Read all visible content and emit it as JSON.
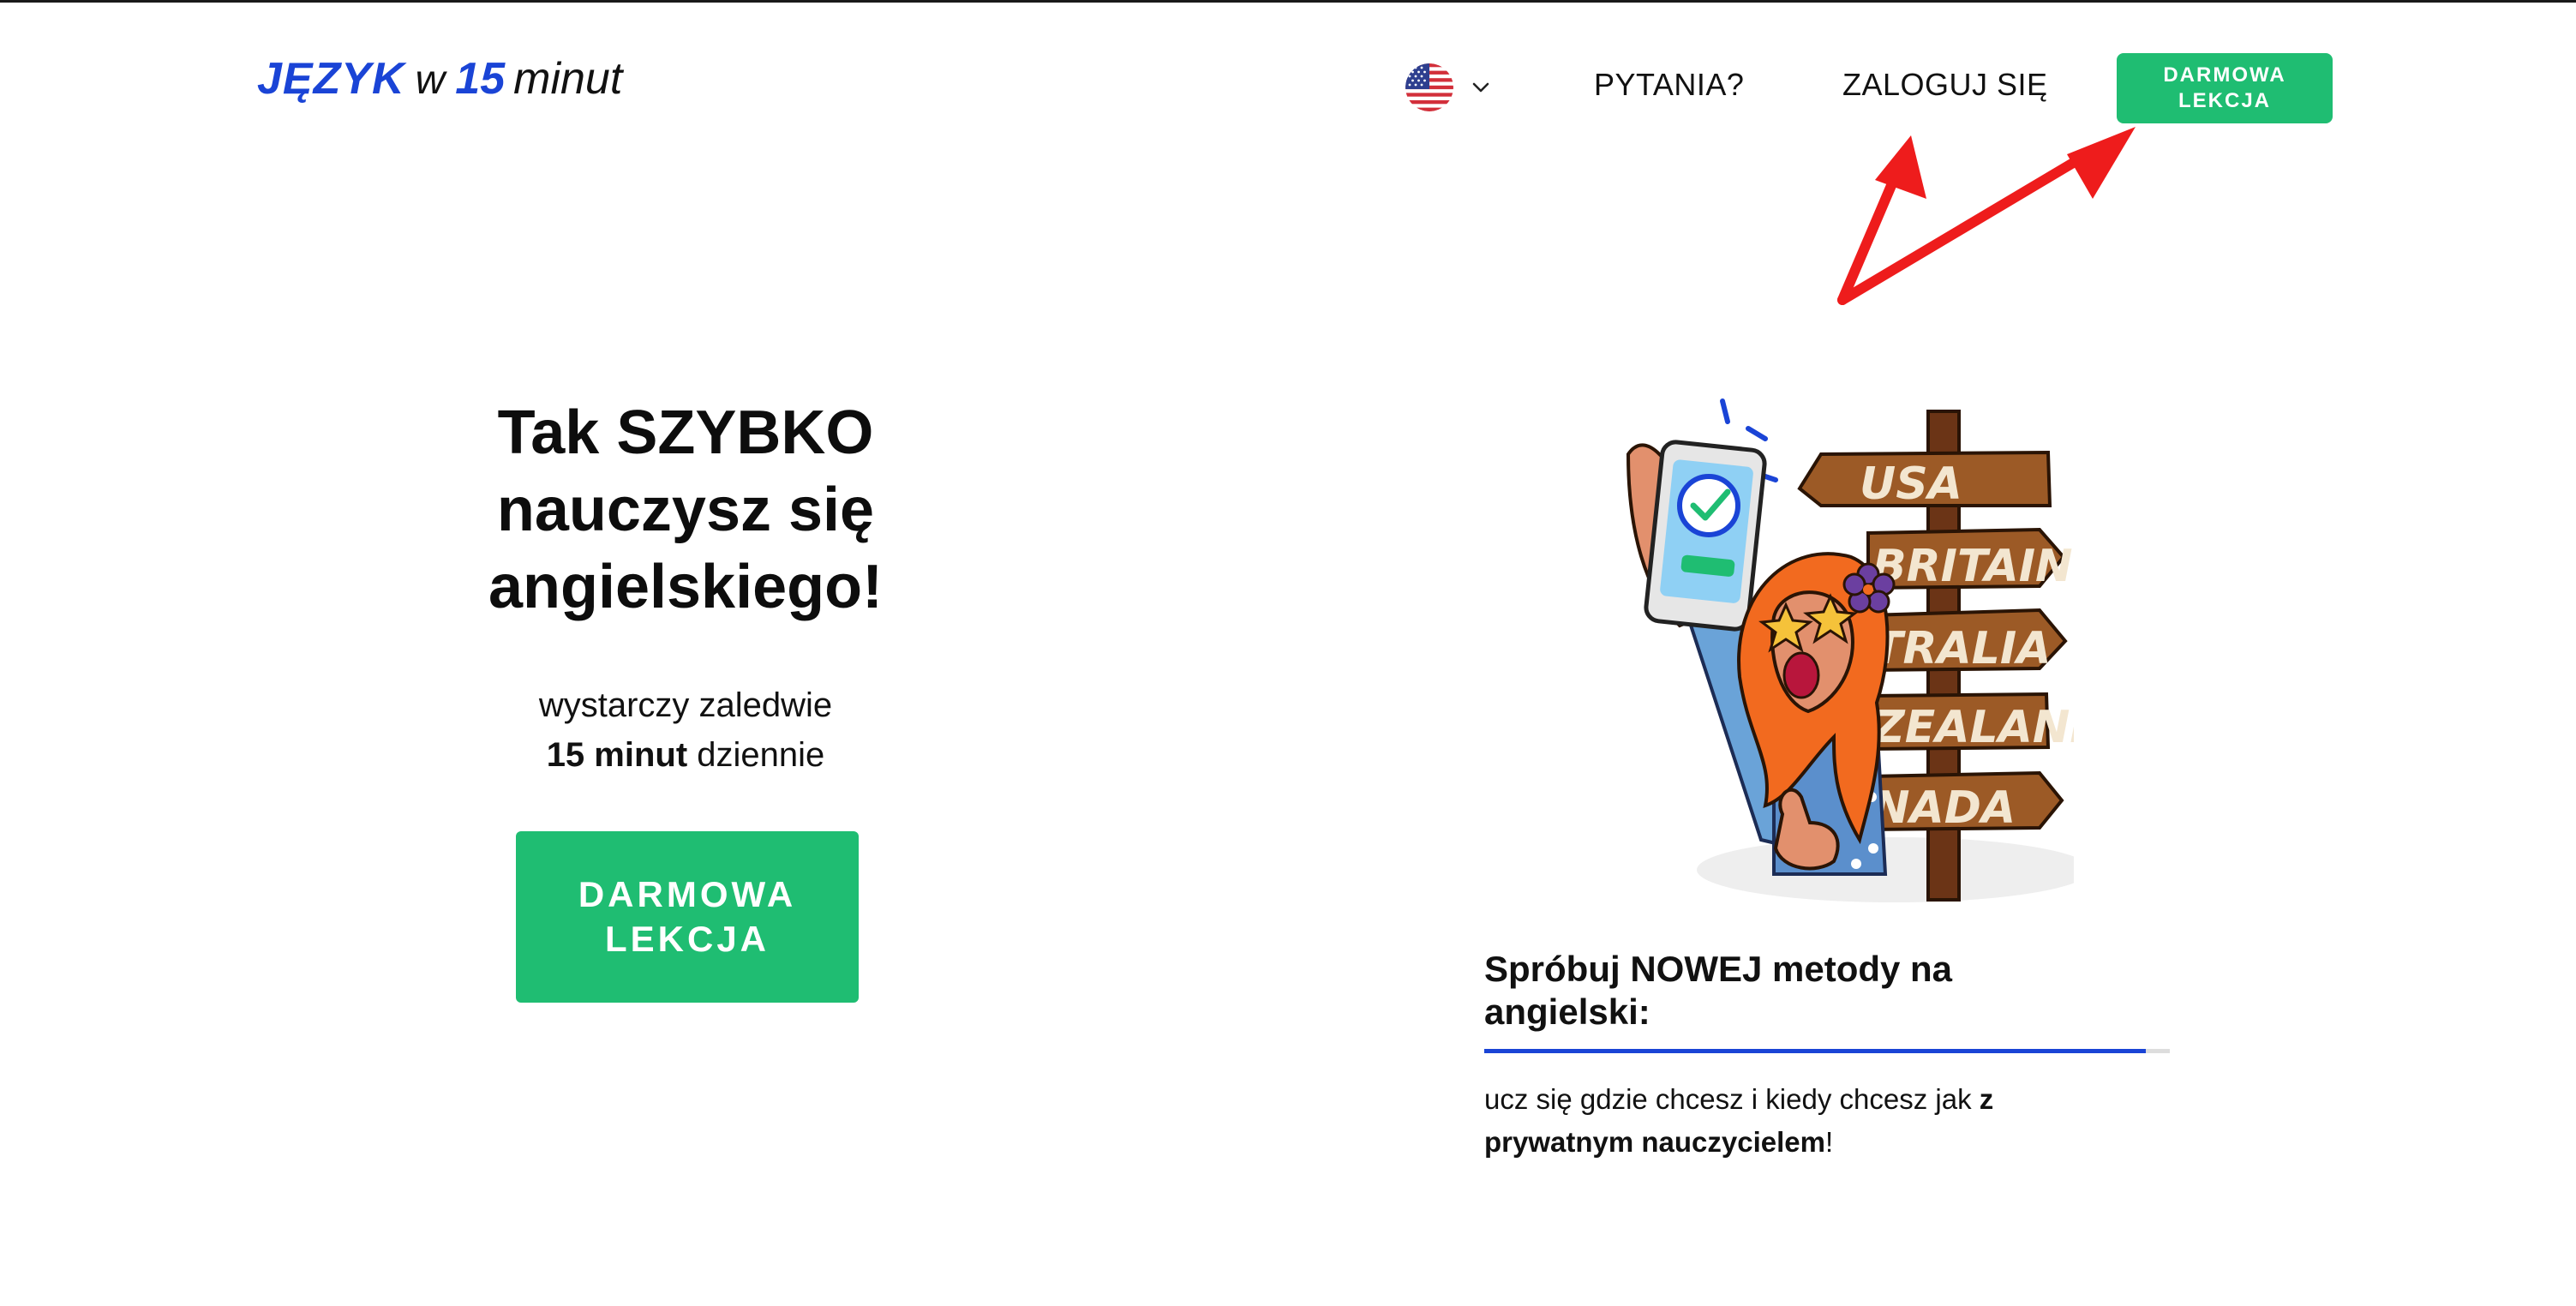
{
  "header": {
    "logo": {
      "part1": "JĘZYK",
      "part2": "w",
      "part3": "15",
      "part4": "minut"
    },
    "language": {
      "flag_icon": "us-flag-icon",
      "chevron_icon": "chevron-down-icon"
    },
    "nav": {
      "questions": "PYTANIA?",
      "login": "ZALOGUJ SIĘ"
    },
    "cta": {
      "line1": "DARMOWA",
      "line2": "LEKCJA"
    }
  },
  "hero": {
    "title_line1": "Tak SZYBKO",
    "title_line2": "nauczysz się",
    "title_line3": "angielskiego!",
    "subtitle_line1": "wystarczy zaledwie",
    "subtitle_bold": "15 minut",
    "subtitle_rest": " dziennie",
    "cta": {
      "line1": "DARMOWA",
      "line2": "LEKCJA"
    }
  },
  "illustration": {
    "signs": [
      "USA",
      "BRITAIN",
      "TRALIA",
      "ZEALAND",
      "NADA"
    ]
  },
  "feature": {
    "title_line1": "Spróbuj NOWEJ metody na",
    "title_line2": "angielski:",
    "progress": 0.965,
    "text_normal": "ucz się gdzie chcesz i kiedy chcesz jak ",
    "text_bold1": "z",
    "text_bold2": "prywatnym nauczycielem",
    "text_end": "!"
  },
  "colors": {
    "accent_blue": "#1a44d6",
    "cta_green": "#1fbd72",
    "annotation_red": "#ee1c1c"
  }
}
